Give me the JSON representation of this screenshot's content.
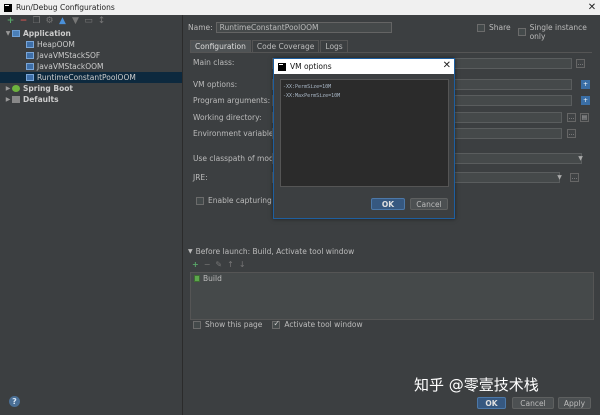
{
  "window": {
    "title": "Run/Debug Configurations",
    "close_glyph": "✕"
  },
  "tree": {
    "nodes": [
      {
        "label": "Application",
        "expanded": true,
        "bold": true
      },
      {
        "label": "HeapOOM"
      },
      {
        "label": "JavaVMStackSOF"
      },
      {
        "label": "JavaVMStackOOM"
      },
      {
        "label": "RuntimeConstantPoolOOM",
        "selected": true
      },
      {
        "label": "Spring Boot",
        "expanded": false,
        "bold": true
      },
      {
        "label": "Defaults",
        "expanded": false,
        "bold": true
      }
    ]
  },
  "header": {
    "name_label": "Name:",
    "name_value": "RuntimeConstantPoolOOM",
    "share_label": "Share",
    "single_label": "Single instance only"
  },
  "tabs": [
    "Configuration",
    "Code Coverage",
    "Logs"
  ],
  "config": {
    "main_class": "Main class:",
    "vm_options": "VM options:",
    "program_args": "Program arguments:",
    "working_dir": "Working directory:",
    "env_vars": "Environment variables:",
    "classpath": "Use classpath of module:",
    "jre": "JRE:",
    "enable_capturing": "Enable capturing for"
  },
  "before_launch": {
    "title": "Before launch: Build, Activate tool window",
    "items": [
      "Build"
    ],
    "show_page": "Show this page",
    "activate_window": "Activate tool window"
  },
  "buttons": {
    "ok": "OK",
    "cancel": "Cancel",
    "apply": "Apply",
    "help": "?"
  },
  "vm_dialog": {
    "title": "VM options",
    "close_glyph": "✕",
    "lines": [
      "-XX:PermSize=10M",
      "-XX:MaxPermSize=10M"
    ],
    "ok": "OK",
    "cancel": "Cancel"
  },
  "watermark": "知乎 @零壹技术栈"
}
